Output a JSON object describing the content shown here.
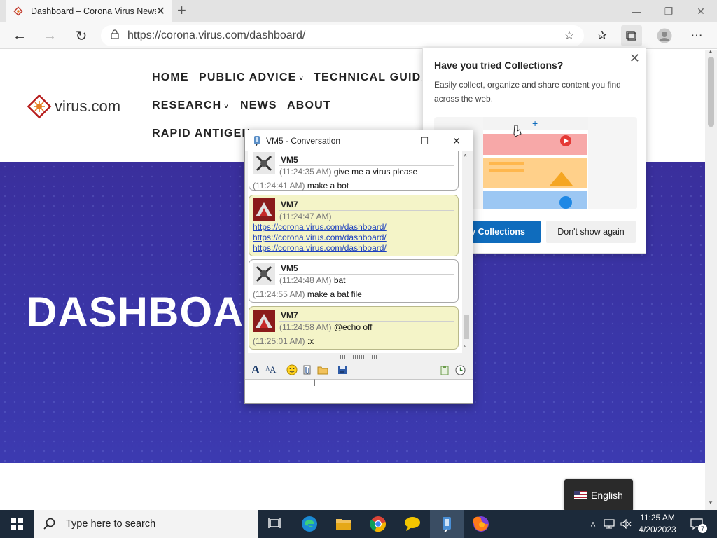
{
  "browser": {
    "tab_title": "Dashboard – Corona Virus News",
    "url": "https://corona.virus.com/dashboard/"
  },
  "site": {
    "logo_text": "virus.com",
    "nav": [
      "HOME",
      "PUBLIC ADVICE",
      "TECHNICAL GUIDA",
      "RESEARCH",
      "NEWS",
      "ABOUT",
      "RAPID ANTIGEN"
    ],
    "hero_title": "DASHBOAR",
    "language": "English"
  },
  "collections_popup": {
    "title": "Have you tried Collections?",
    "description": "Easily collect, organize and share content you find across the web.",
    "primary_button": "y Collections",
    "secondary_button": "Don't show again"
  },
  "conversation": {
    "window_title": "VM5 - Conversation",
    "messages": [
      {
        "sender": "VM5",
        "lines": [
          {
            "time": "(11:24:35 AM)",
            "text": " give me a virus please"
          },
          {
            "time": "(11:24:41 AM)",
            "text": " make a bot"
          }
        ]
      },
      {
        "sender": "VM7",
        "time": "(11:24:47 AM)",
        "links": [
          "https://corona.virus.com/dashboard/",
          "https://corona.virus.com/dashboard/",
          "https://corona.virus.com/dashboard/"
        ]
      },
      {
        "sender": "VM5",
        "lines": [
          {
            "time": "(11:24:48 AM)",
            "text": " bat"
          },
          {
            "time": "(11:24:55 AM)",
            "text": " make a bat file"
          }
        ]
      },
      {
        "sender": "VM7",
        "lines": [
          {
            "time": "(11:24:58 AM)",
            "text": " @echo off"
          },
          {
            "time": "(11:25:01 AM)",
            "text": " :x"
          }
        ]
      }
    ]
  },
  "taskbar": {
    "search_placeholder": "Type here to search",
    "time": "11:25 AM",
    "date": "4/20/2023",
    "notification_count": "7"
  },
  "colors": {
    "hero_bg": "#3a36a8",
    "vm7_bubble": "#f4f4c8",
    "accent_blue": "#0f6cbd",
    "taskbar": "#1c2a3a"
  }
}
